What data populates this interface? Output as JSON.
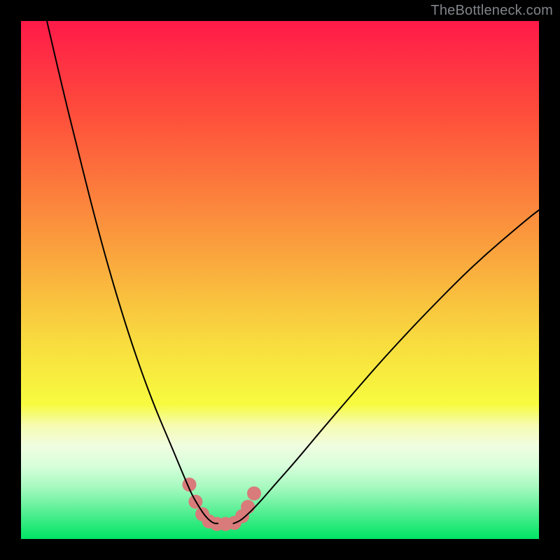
{
  "attribution": "TheBottleneck.com",
  "chart_data": {
    "type": "line",
    "title": "",
    "xlabel": "",
    "ylabel": "",
    "xlim": [
      0,
      100
    ],
    "ylim": [
      0,
      100
    ],
    "background_gradient_stops": [
      {
        "offset": 0,
        "color": "#ff1a49"
      },
      {
        "offset": 18,
        "color": "#fe4e3b"
      },
      {
        "offset": 40,
        "color": "#fb943d"
      },
      {
        "offset": 62,
        "color": "#f8dc3f"
      },
      {
        "offset": 74,
        "color": "#f7fb3f"
      },
      {
        "offset": 78,
        "color": "#f6fbb0"
      },
      {
        "offset": 82,
        "color": "#f0fde0"
      },
      {
        "offset": 86,
        "color": "#d6feda"
      },
      {
        "offset": 90,
        "color": "#a6f9bf"
      },
      {
        "offset": 93,
        "color": "#74f3a4"
      },
      {
        "offset": 96,
        "color": "#40ec87"
      },
      {
        "offset": 100,
        "color": "#00e464"
      }
    ],
    "series": [
      {
        "name": "left-curve",
        "x": [
          5,
          8,
          11,
          14,
          17,
          20,
          23,
          26,
          29,
          31.5,
          33,
          34.5,
          35.5,
          36.5,
          37.3,
          38
        ],
        "y": [
          100,
          87,
          75,
          63,
          52,
          42,
          33,
          25,
          18,
          12,
          8.5,
          6,
          4.5,
          3.5,
          3,
          3
        ]
      },
      {
        "name": "right-curve",
        "x": [
          41,
          42,
          43.5,
          46,
          49,
          53,
          58,
          64,
          71,
          79,
          88,
          98,
          100
        ],
        "y": [
          3,
          3.3,
          4.5,
          7,
          10.5,
          15,
          21,
          28,
          36,
          44.5,
          53.5,
          62,
          63.5
        ]
      }
    ],
    "valley_dots": [
      {
        "x": 32.5,
        "y": 10.5
      },
      {
        "x": 33.7,
        "y": 7.2
      },
      {
        "x": 35.0,
        "y": 4.8
      },
      {
        "x": 36.3,
        "y": 3.4
      },
      {
        "x": 37.8,
        "y": 2.9
      },
      {
        "x": 39.5,
        "y": 2.9
      },
      {
        "x": 41.2,
        "y": 3.1
      },
      {
        "x": 42.7,
        "y": 4.4
      },
      {
        "x": 43.8,
        "y": 6.2
      },
      {
        "x": 45.0,
        "y": 8.8
      }
    ],
    "valley_dot_color": "#d97b7a",
    "valley_dot_radius_px": 10,
    "curve_stroke_color": "#000000",
    "curve_stroke_width_px": 2
  }
}
